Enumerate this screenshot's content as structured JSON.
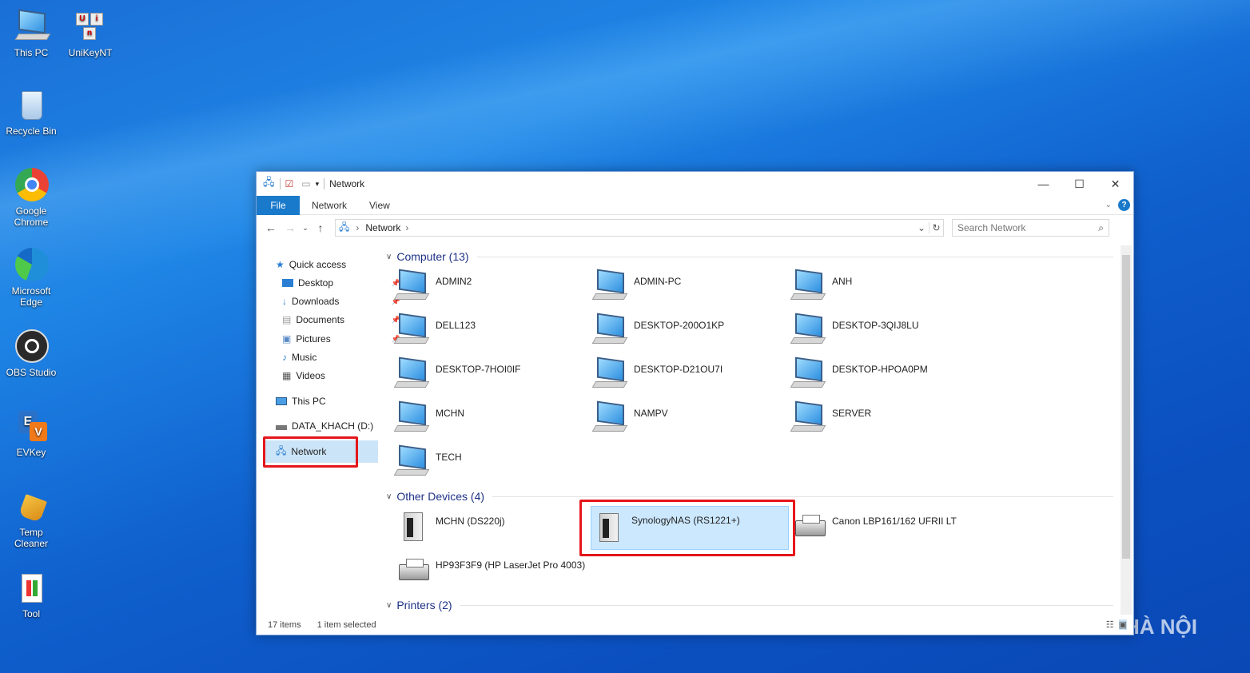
{
  "desktop": {
    "icons": [
      {
        "label": "This PC"
      },
      {
        "label": "UniKeyNT"
      },
      {
        "label": "Recycle Bin"
      },
      {
        "label": "Google Chrome"
      },
      {
        "label": "Microsoft Edge"
      },
      {
        "label": "OBS Studio"
      },
      {
        "label": "EVKey"
      },
      {
        "label": "Temp Cleaner"
      },
      {
        "label": "Tool"
      }
    ],
    "watermark": "HÀ NỘI"
  },
  "window": {
    "title": "Network",
    "caption": {
      "minimize": "—",
      "maximize": "☐",
      "close": "✕"
    },
    "ribbon": {
      "file": "File",
      "tabs": [
        "Network",
        "View"
      ],
      "help": "?"
    },
    "address": {
      "path_root_icon": "network-icon",
      "crumb": "Network",
      "sep": "›"
    },
    "search_placeholder": "Search Network",
    "nav": {
      "quick_access": "Quick access",
      "items": [
        {
          "label": "Desktop",
          "pinned": true
        },
        {
          "label": "Downloads",
          "pinned": true
        },
        {
          "label": "Documents",
          "pinned": true
        },
        {
          "label": "Pictures",
          "pinned": true
        },
        {
          "label": "Music",
          "pinned": false
        },
        {
          "label": "Videos",
          "pinned": false
        }
      ],
      "this_pc": "This PC",
      "drive": "DATA_KHACH (D:)",
      "network": "Network"
    },
    "groups": {
      "computer": {
        "title": "Computer (13)",
        "items": [
          "ADMIN2",
          "ADMIN-PC",
          "ANH",
          "DELL123",
          "DESKTOP-200O1KP",
          "DESKTOP-3QIJ8LU",
          "DESKTOP-7HOI0IF",
          "DESKTOP-D21OU7I",
          "DESKTOP-HPOA0PM",
          "MCHN",
          "NAMPV",
          "SERVER",
          "TECH"
        ]
      },
      "other": {
        "title": "Other Devices (4)",
        "items": [
          "MCHN (DS220j)",
          "SynologyNAS (RS1221+)",
          "Canon LBP161/162 UFRII LT",
          "HP93F3F9 (HP LaserJet Pro 4003)"
        ]
      },
      "printers": {
        "title": "Printers (2)"
      }
    },
    "status": {
      "count": "17 items",
      "selected": "1 item selected"
    }
  }
}
